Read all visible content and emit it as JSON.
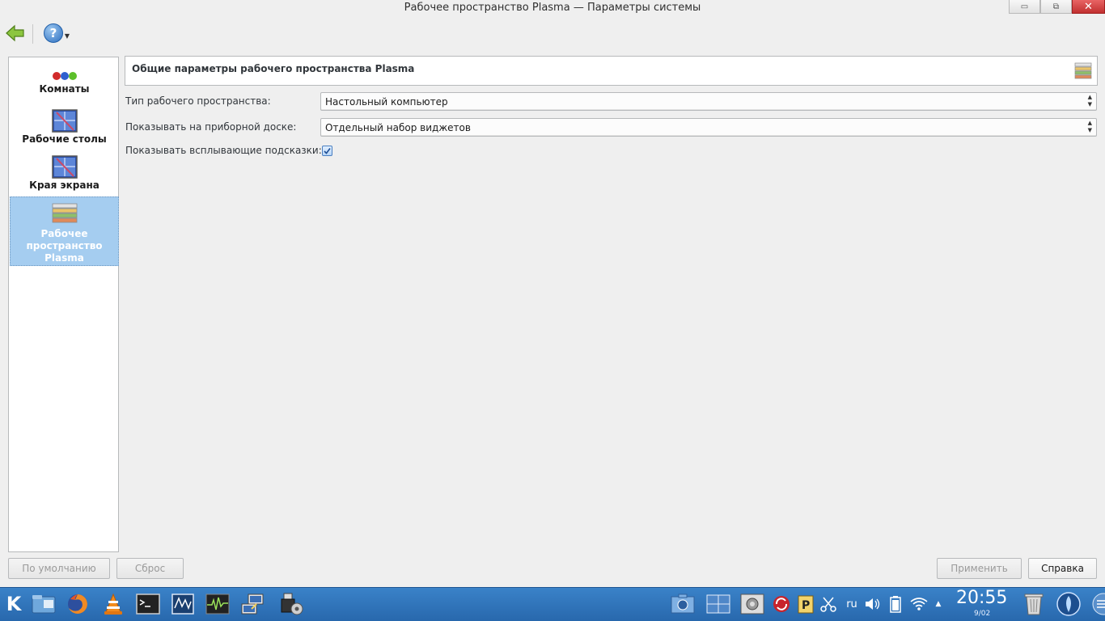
{
  "window": {
    "title": "Рабочее пространство Plasma — Параметры системы",
    "minimize_glyph": "▭",
    "maximize_glyph": "⧉",
    "close_glyph": "✕"
  },
  "toolbar": {
    "back_icon": "back-arrow-icon",
    "help_glyph": "?",
    "help_dropdown_glyph": "▼"
  },
  "sidebar": {
    "items": [
      {
        "label": "Комнаты",
        "icon": "activities-icon",
        "selected": false
      },
      {
        "label": "Рабочие столы",
        "icon": "virtual-desktops-icon",
        "selected": false
      },
      {
        "label": "Края экрана",
        "icon": "screen-edges-icon",
        "selected": false
      },
      {
        "label": "Рабочее пространство Plasma",
        "icon": "plasma-workspace-icon",
        "selected": true
      }
    ]
  },
  "main": {
    "header_title": "Общие параметры рабочего пространства Plasma",
    "workspace_type": {
      "label": "Тип рабочего пространства:",
      "value": "Настольный компьютер"
    },
    "dashboard": {
      "label": "Показывать на приборной доске:",
      "value": "Отдельный набор виджетов"
    },
    "tooltips": {
      "label": "Показывать всплывающие подсказки:",
      "checked": true
    }
  },
  "buttons": {
    "defaults": "По умолчанию",
    "reset": "Сброс",
    "apply": "Применить",
    "help": "Справка"
  },
  "taskbar": {
    "launcher_glyph": "K",
    "apps": [
      "file-manager-icon",
      "firefox-icon",
      "vlc-icon",
      "terminal-icon",
      "system-monitor-icon",
      "activity-monitor-icon",
      "network-icon",
      "usb-settings-icon"
    ],
    "tray": [
      "screenshot-icon",
      "window-list-icon",
      "settings-icon",
      "update-icon",
      "clipboard-icon",
      "scissors-icon",
      "keyboard-layout-icon",
      "volume-icon",
      "battery-icon",
      "wifi-icon",
      "tray-expand-icon",
      "trash-icon",
      "plasma-icon"
    ],
    "keyboard_layout": "ru",
    "clock": "20:55",
    "date": "9/02"
  },
  "colors": {
    "selection": "#a5cdf0",
    "taskbar": "#3079c0",
    "accent": "#3daee9"
  }
}
